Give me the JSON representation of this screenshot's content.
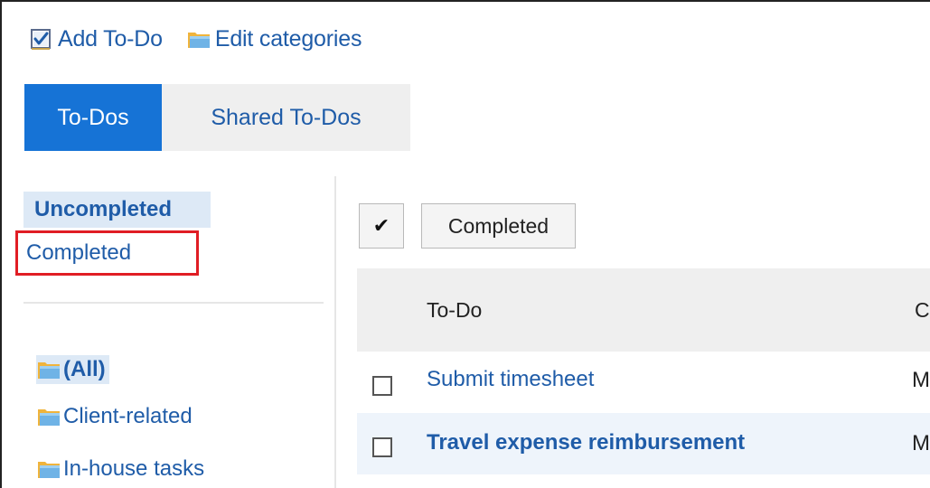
{
  "toolbar": {
    "add_todo_label": "Add To-Do",
    "edit_categories_label": "Edit categories"
  },
  "tabs": [
    {
      "label": "To-Dos",
      "active": true
    },
    {
      "label": "Shared To-Dos",
      "active": false
    }
  ],
  "sidebar": {
    "status_filters": [
      {
        "label": "Uncompleted",
        "selected": true
      },
      {
        "label": "Completed",
        "selected": false,
        "highlighted": true
      }
    ],
    "categories": [
      {
        "label": "(All)",
        "selected": true
      },
      {
        "label": "Client-related",
        "selected": false
      },
      {
        "label": "In-house tasks",
        "selected": false
      }
    ]
  },
  "actions": {
    "check_glyph": "✔",
    "completed_button_label": "Completed"
  },
  "table": {
    "columns": [
      "To-Do",
      "C"
    ],
    "rows": [
      {
        "title": "Submit timesheet",
        "bold": false,
        "col2": "M"
      },
      {
        "title": "Travel expense reimbursement",
        "bold": true,
        "col2": "M"
      }
    ]
  },
  "colors": {
    "accent": "#1673d6",
    "link": "#1f5ca8",
    "selected_bg": "#dde9f6",
    "highlight_border": "#e01d24",
    "header_bg": "#efefef"
  },
  "icons": {
    "add_todo": "checked-todo-icon",
    "edit_categories": "folder-icon",
    "category": "folder-icon"
  }
}
